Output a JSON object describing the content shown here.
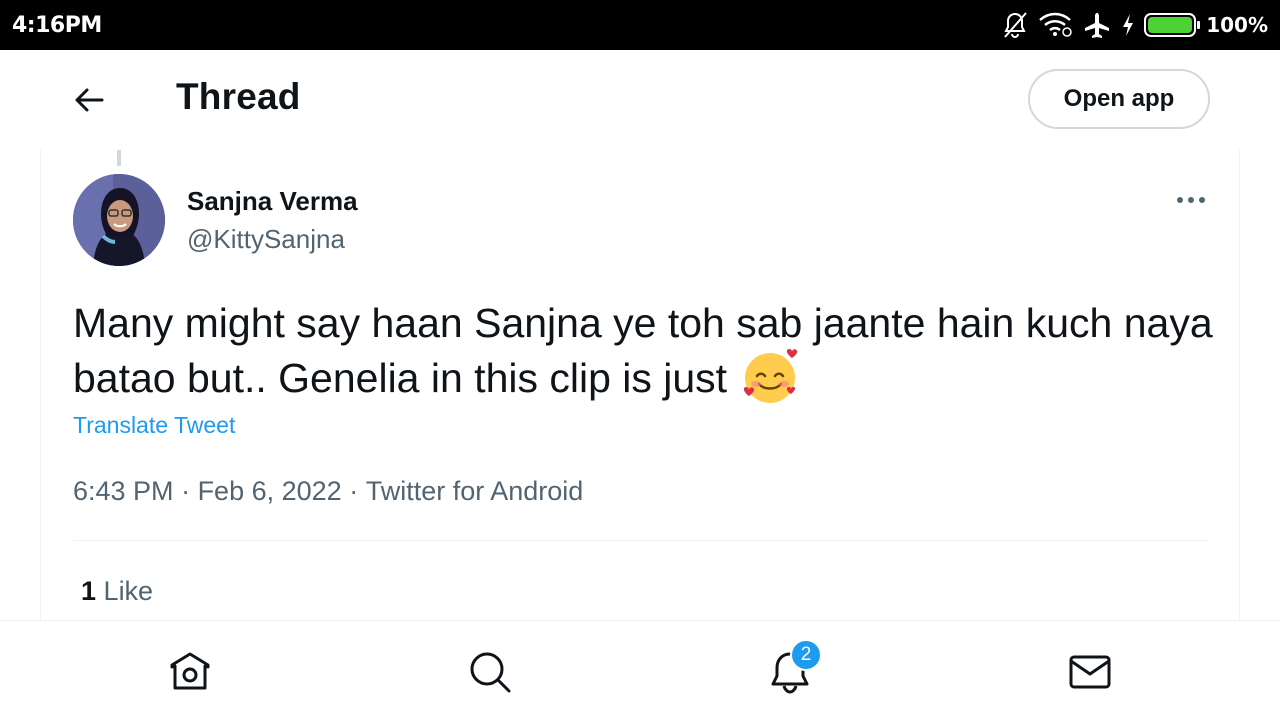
{
  "status_bar": {
    "time": "4:16PM",
    "battery_percent": "100%",
    "battery_level": 1.0,
    "icons": [
      "bell-off-icon",
      "wifi-icon",
      "airplane-icon",
      "charging-icon",
      "battery-icon"
    ]
  },
  "header": {
    "title": "Thread",
    "open_app_label": "Open app",
    "back_icon": "arrow-left-icon"
  },
  "tweet": {
    "author_name": "Sanjna Verma",
    "author_handle": "@KittySanjna",
    "text": "Many might say haan Sanjna ye toh sab jaante hain kuch naya batao but.. Genelia in this clip is just",
    "emoji": "smiling-face-with-hearts",
    "translate_label": "Translate Tweet",
    "time": "6:43 PM",
    "date": "Feb 6, 2022",
    "source": "Twitter for Android",
    "separator": " · ",
    "likes_count": "1",
    "likes_label": "Like"
  },
  "bottom_nav": {
    "items": [
      "home-icon",
      "search-icon",
      "notifications-icon",
      "messages-icon"
    ],
    "notification_badge": "2"
  },
  "colors": {
    "accent": "#1d9bf0",
    "text_primary": "#0f1419",
    "text_secondary": "#536471",
    "border": "#eff3f4",
    "battery": "#4cd137"
  }
}
